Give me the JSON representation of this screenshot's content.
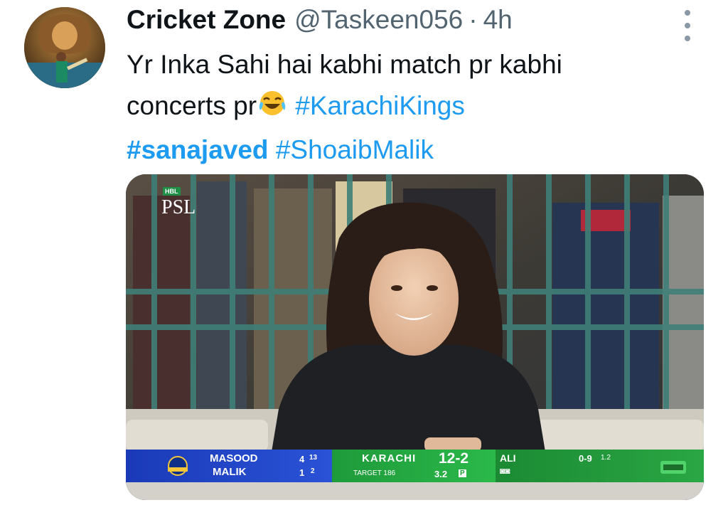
{
  "tweet": {
    "display_name": "Cricket Zone",
    "handle": "@Taskeen056",
    "separator": "·",
    "time": "4h",
    "text_line1": "Yr Inka Sahi hai kabhi match pr kabhi",
    "text_line2_prefix": "concerts pr",
    "hashtag1": "#KarachiKings",
    "hashtag2": "#sanajaved",
    "hashtag3": "#ShoaibMalik",
    "emoji": "face-with-tears-of-joy",
    "link_color": "#1d9bf0"
  },
  "media": {
    "logo_badge": "HBL",
    "logo_text": "PSL",
    "score": {
      "batter1": "MASOOD",
      "batter2": "MALIK",
      "b1_runs": "4",
      "b1_balls": "13",
      "b2_runs": "1",
      "b2_balls": "2",
      "team": "KARACHI",
      "score": "12-2",
      "target": "TARGET 186",
      "overs": "3.2",
      "powerplay": "P",
      "bowler": "ALI",
      "bowler_figures": "0-9",
      "bowler_overs": "1.2"
    }
  }
}
